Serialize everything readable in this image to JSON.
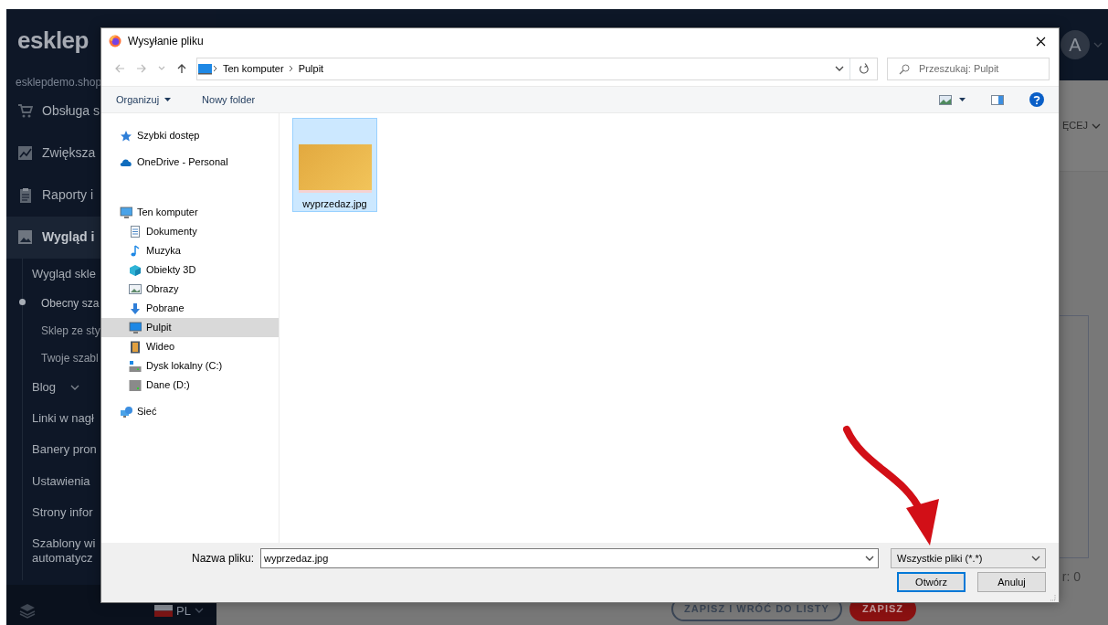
{
  "background_app": {
    "logo": "esklep",
    "domain": "esklepdemo.shop",
    "sidebar": {
      "items": [
        {
          "label": "Obsługa s",
          "selected": false
        },
        {
          "label": "Zwiększa",
          "selected": false
        },
        {
          "label": "Raporty i",
          "selected": false
        },
        {
          "label": "Wygląd i",
          "selected": true,
          "children": [
            {
              "label": "Wygląd skle",
              "children": [
                {
                  "label": "Obecny sza",
                  "selected": true
                },
                {
                  "label": "Sklep ze sty",
                  "selected": false
                },
                {
                  "label": "Twoje szabl",
                  "selected": false
                }
              ]
            },
            {
              "label": "Blog",
              "expanded": false
            },
            {
              "label": "Linki w nagł"
            },
            {
              "label": "Banery pron"
            },
            {
              "label": "Ustawienia"
            },
            {
              "label": "Strony infor"
            },
            {
              "label": "Szablony wi\nautomatycz"
            }
          ]
        }
      ]
    },
    "language": "PL",
    "avatar": "A",
    "more_menu": "ĘCEJ",
    "counter": "r: 0",
    "buttons": [
      {
        "label": "ZAPISZ I WRÓĆ DO LISTY",
        "kind": "outline"
      },
      {
        "label": "ZAPISZ",
        "kind": "primary"
      }
    ]
  },
  "dialog": {
    "title": "Wysyłanie pliku",
    "path": [
      "Ten komputer",
      "Pulpit"
    ],
    "search": {
      "placeholder": "Przeszukaj: Pulpit"
    },
    "toolbar": [
      {
        "label": "Organizuj",
        "kind": "menu"
      },
      {
        "label": "Nowy folder",
        "kind": "button"
      }
    ],
    "nav": [
      {
        "label": "Szybki dostęp",
        "selected": false
      },
      {
        "label": "OneDrive - Personal",
        "selected": false
      },
      {
        "label": "Ten komputer",
        "selected": false,
        "children": [
          {
            "label": "Dokumenty",
            "selected": false
          },
          {
            "label": "Muzyka",
            "selected": false
          },
          {
            "label": "Obiekty 3D",
            "selected": false
          },
          {
            "label": "Obrazy",
            "selected": false
          },
          {
            "label": "Pobrane",
            "selected": false
          },
          {
            "label": "Pulpit",
            "selected": true
          },
          {
            "label": "Wideo",
            "selected": false
          },
          {
            "label": "Dysk lokalny (C:)",
            "selected": false
          },
          {
            "label": "Dane (D:)",
            "selected": false
          }
        ]
      },
      {
        "label": "Sieć",
        "selected": false
      }
    ],
    "files": [
      {
        "name": "wyprzedaz.jpg",
        "selected": true
      }
    ],
    "file_name": {
      "label": "Nazwa pliku:",
      "value": "wyprzedaz.jpg"
    },
    "file_type": {
      "value": "Wszystkie pliki (*.*)"
    },
    "buttons": [
      {
        "label": "Otwórz",
        "kind": "default"
      },
      {
        "label": "Anuluj",
        "kind": "normal"
      }
    ]
  }
}
